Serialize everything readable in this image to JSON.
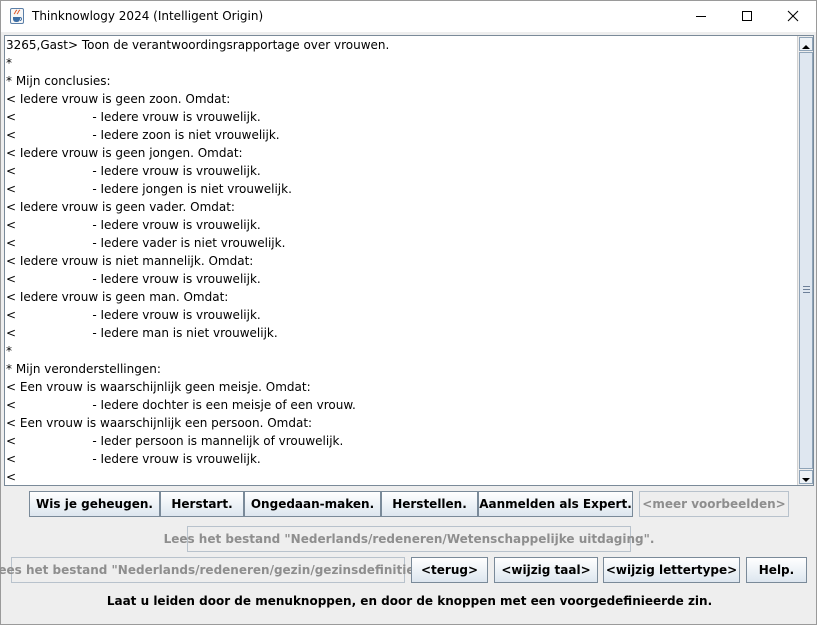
{
  "window": {
    "title": "Thinknowlogy 2024 (Intelligent Origin)",
    "controls": [
      "minimize",
      "maximize",
      "close"
    ]
  },
  "output": {
    "lines": [
      "3265,Gast> Toon de verantwoordingsrapportage over vrouwen.",
      "*",
      "* Mijn conclusies:",
      "< Iedere vrouw is geen zoon. Omdat:",
      "<                    - Iedere vrouw is vrouwelijk.",
      "<                    - Iedere zoon is niet vrouwelijk.",
      "< Iedere vrouw is geen jongen. Omdat:",
      "<                    - Iedere vrouw is vrouwelijk.",
      "<                    - Iedere jongen is niet vrouwelijk.",
      "< Iedere vrouw is geen vader. Omdat:",
      "<                    - Iedere vrouw is vrouwelijk.",
      "<                    - Iedere vader is niet vrouwelijk.",
      "< Iedere vrouw is niet mannelijk. Omdat:",
      "<                    - Iedere vrouw is vrouwelijk.",
      "< Iedere vrouw is geen man. Omdat:",
      "<                    - Iedere vrouw is vrouwelijk.",
      "<                    - Iedere man is niet vrouwelijk.",
      "*",
      "* Mijn veronderstellingen:",
      "< Een vrouw is waarschijnlijk geen meisje. Omdat:",
      "<                    - Iedere dochter is een meisje of een vrouw.",
      "< Een vrouw is waarschijnlijk een persoon. Omdat:",
      "<                    - Ieder persoon is mannelijk of vrouwelijk.",
      "<                    - Iedere vrouw is vrouwelijk.",
      "<"
    ]
  },
  "buttons": {
    "row1": {
      "clear_memory": "Wis je geheugen.",
      "restart": "Herstart.",
      "undo": "Ongedaan-maken.",
      "redo": "Herstellen.",
      "login_expert": "Aanmelden als Expert.",
      "more_examples": "<meer voorbeelden>"
    },
    "row2": {
      "read_file_challenge": "Lees het bestand \"Nederlands/redeneren/Wetenschappelijke uitdaging\"."
    },
    "row3": {
      "read_file_family": "Lees het bestand \"Nederlands/redeneren/gezin/gezinsdefinitie\".",
      "back": "<terug>",
      "change_language": "<wijzig taal>",
      "change_font": "<wijzig lettertype>",
      "help": "Help."
    }
  },
  "status": {
    "text": "Laat u leiden door de menuknoppen, en door de knoppen met een voorgedefinieerde zin."
  },
  "scrollbar": {
    "thumb_fraction": 1.0
  }
}
